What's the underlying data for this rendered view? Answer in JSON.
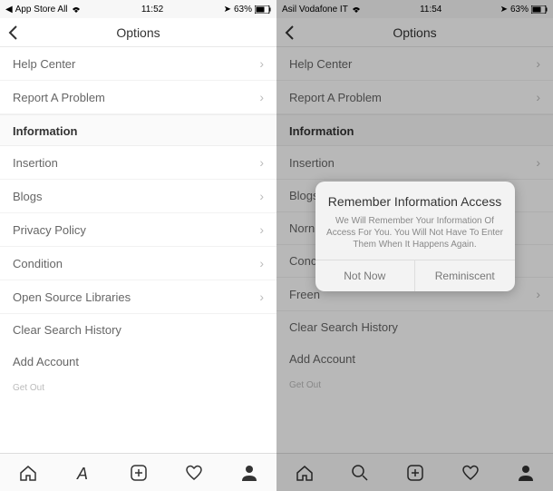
{
  "left": {
    "status": {
      "carrier": "App Store All",
      "time": "11:52",
      "battery": "63%"
    },
    "nav": {
      "title": "Options"
    },
    "rows": {
      "help": "Help Center",
      "report": "Report A Problem",
      "section": "Information",
      "insertion": "Insertion",
      "blogs": "Blogs",
      "privacy": "Privacy Policy",
      "condition": "Condition",
      "opensource": "Open Source Libraries",
      "clear": "Clear Search History",
      "add": "Add Account",
      "getout": "Get Out"
    }
  },
  "right": {
    "status": {
      "carrier": "Asil Vodafone IT",
      "time": "11:54",
      "battery": "63%"
    },
    "nav": {
      "title": "Options"
    },
    "rows": {
      "help": "Help Center",
      "report": "Report A Problem",
      "section": "Information",
      "insertion": "Insertion",
      "blogs": "Blogs",
      "norm": "Norn",
      "conc": "Conc",
      "freen": "Freen",
      "clear": "Clear Search History",
      "add": "Add Account",
      "getout": "Get Out"
    },
    "modal": {
      "title": "Remember Information Access",
      "message": "We Will Remember Your Information Of Access For You. You Will Not Have To Enter Them When It Happens Again.",
      "notnow": "Not Now",
      "ok": "Reminiscent"
    }
  }
}
